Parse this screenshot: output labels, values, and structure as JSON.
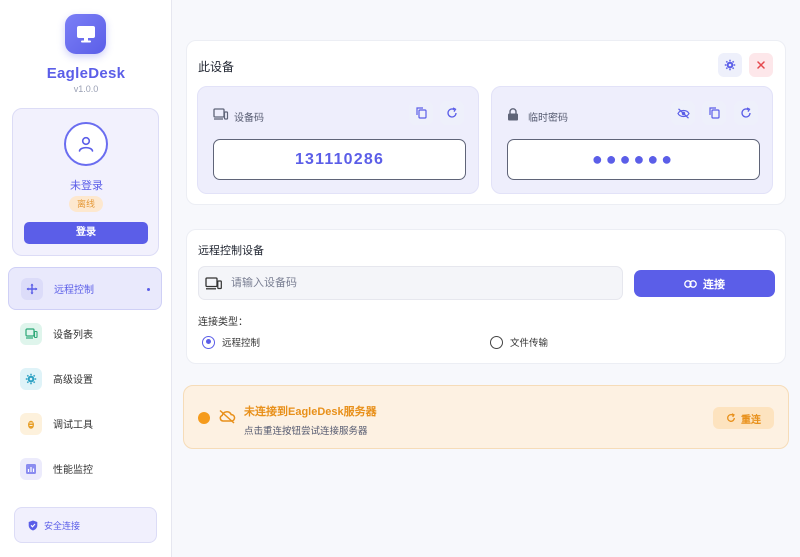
{
  "app": {
    "name": "EagleDesk",
    "version": "v1.0.0"
  },
  "user": {
    "name": "未登录",
    "status": "离线",
    "login_label": "登录"
  },
  "nav": [
    {
      "label": "远程控制",
      "icon": "move-icon",
      "active": true
    },
    {
      "label": "设备列表",
      "icon": "devices-icon",
      "active": false
    },
    {
      "label": "高级设置",
      "icon": "gear-icon",
      "active": false
    },
    {
      "label": "调试工具",
      "icon": "bug-icon",
      "active": false
    },
    {
      "label": "性能监控",
      "icon": "chart-icon",
      "active": false
    }
  ],
  "security": {
    "label": "安全连接"
  },
  "this_device": {
    "title": "此设备",
    "device_code": {
      "label": "设备码",
      "value": "131110286"
    },
    "temp_password": {
      "label": "临时密码",
      "value": "●●●●●●"
    }
  },
  "remote": {
    "title": "远程控制设备",
    "input_placeholder": "请输入设备码",
    "connect_label": "连接",
    "conn_type_label": "连接类型：",
    "options": [
      {
        "label": "远程控制",
        "checked": true
      },
      {
        "label": "文件传输",
        "checked": false
      }
    ]
  },
  "alert": {
    "title": "未连接到EagleDesk服务器",
    "subtitle": "点击重连按钮尝试连接服务器",
    "retry_label": "重连"
  },
  "colors": {
    "accent": "#5b5ee8",
    "warning": "#f59b1c",
    "danger": "#e5484d"
  }
}
